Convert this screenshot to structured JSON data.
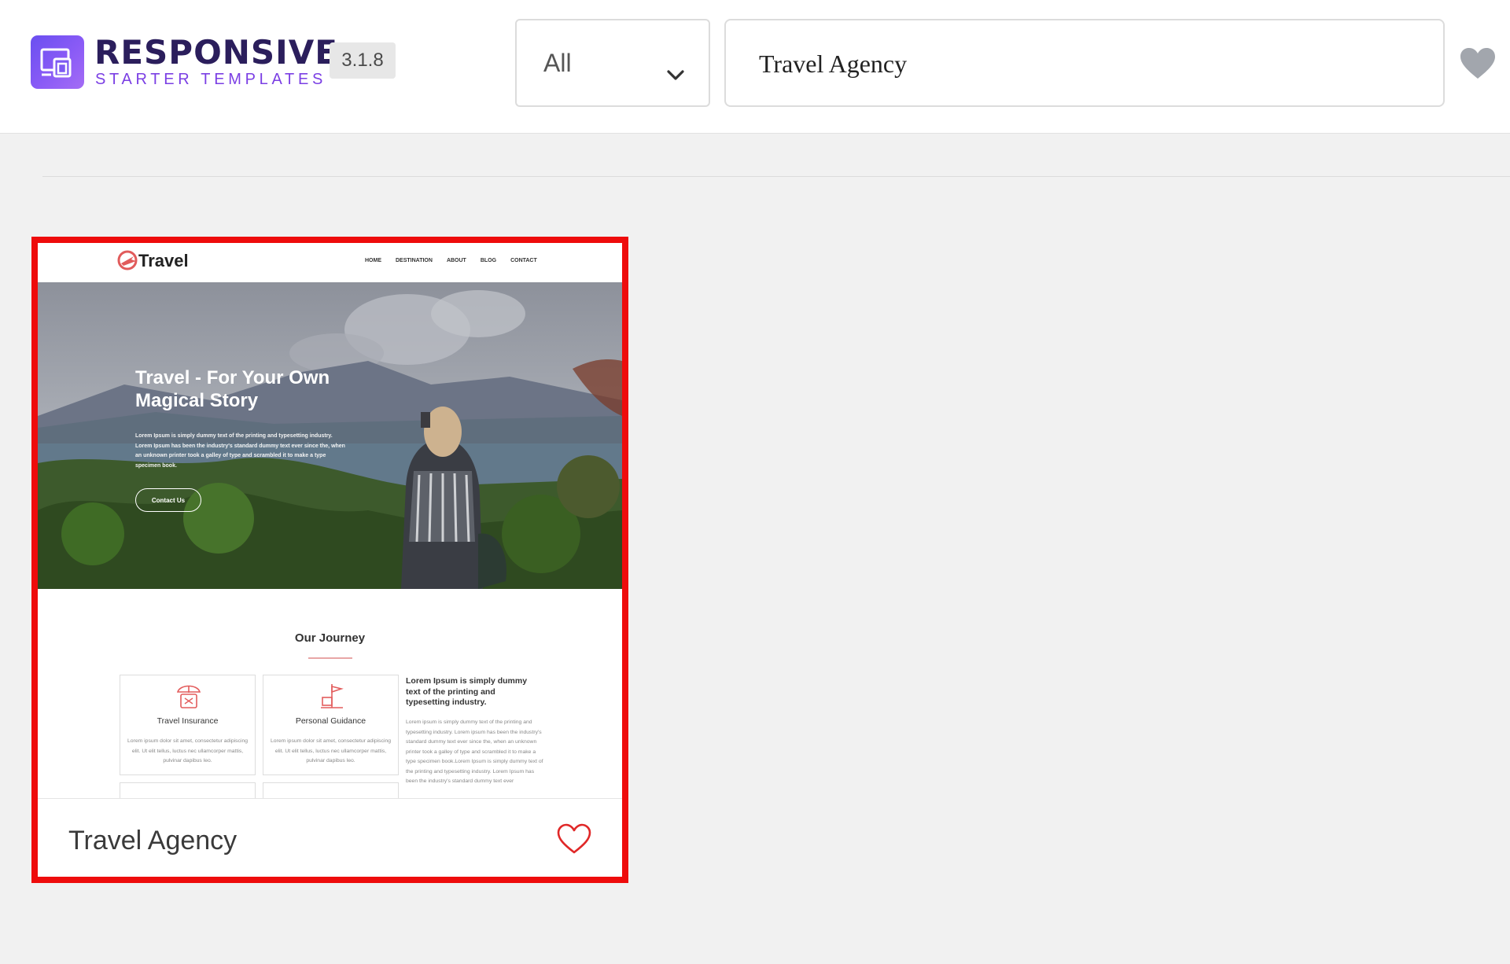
{
  "brand": {
    "title": "RESPONSIVE",
    "subtitle": "STARTER TEMPLATES",
    "version": "3.1.8",
    "logo_icon": "responsive-devices-icon",
    "accent": "#7b3fe4",
    "title_color": "#2b1e5c"
  },
  "toolbar": {
    "filter_value": "All",
    "filter_icon": "chevron-down-icon",
    "search_value": "Travel Agency",
    "favorites_icon": "heart-filled-icon"
  },
  "card": {
    "title": "Travel Agency",
    "favorite_icon": "heart-outline-icon",
    "highlight_color": "#ee0c0c",
    "preview": {
      "site_logo": "Travel",
      "nav": [
        "HOME",
        "DESTINATION",
        "ABOUT",
        "BLOG",
        "CONTACT"
      ],
      "hero_title": "Travel - For Your Own Magical Story",
      "hero_text": "Lorem Ipsum is simply dummy text of the printing and typesetting industry. Lorem Ipsum has been the industry's standard dummy text ever since the, when an unknown printer took a galley of type and scrambled it to make a type specimen book.",
      "hero_button": "Contact Us",
      "section_title": "Our Journey",
      "services": [
        {
          "title": "Travel Insurance",
          "text": "Lorem ipsum dolor sit amet, consectetur adipiscing elit. Ut elit tellus, luctus nec ullamcorper mattis, pulvinar dapibus leo.",
          "icon": "umbrella-luggage-icon"
        },
        {
          "title": "Personal Guidance",
          "text": "Lorem ipsum dolor sit amet, consectetur adipiscing elit. Ut elit tellus, luctus nec ullamcorper mattis, pulvinar dapibus leo.",
          "icon": "signpost-icon"
        }
      ],
      "side_title": "Lorem Ipsum is simply dummy text of the printing and typesetting industry.",
      "side_text": "Lorem ipsum is simply dummy text of the printing and typesetting industry. Lorem ipsum has been the industry's standard dummy text ever since the, when an unknown printer took a galley of type and scrambled it to make a type specimen book.Lorem Ipsum is simply dummy text of the printing and typesetting industry. Lorem Ipsum has been the industry's standard dummy text ever"
    }
  }
}
